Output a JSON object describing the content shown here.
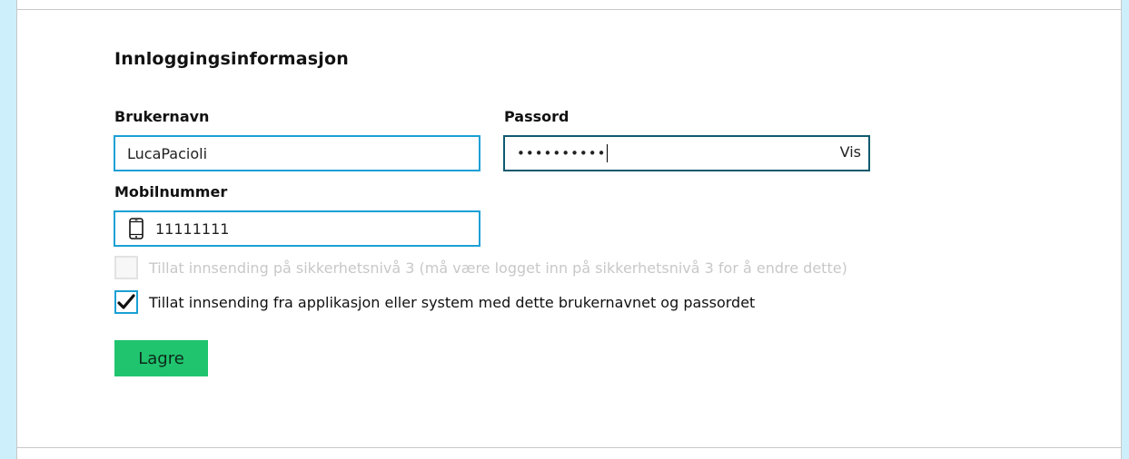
{
  "section": {
    "title": "Innloggingsinformasjon"
  },
  "username": {
    "label": "Brukernavn",
    "value": "LucaPacioli"
  },
  "password": {
    "label": "Passord",
    "masked_value": "••••••••••",
    "show_label": "Vis"
  },
  "mobile": {
    "label": "Mobilnummer",
    "value": "11111111",
    "icon": "mobile-phone-icon"
  },
  "checkboxes": [
    {
      "label": "Tillat innsending på sikkerhetsnivå 3 (må være logget inn på sikkerhetsnivå 3 for å endre dette)",
      "checked": false,
      "disabled": true
    },
    {
      "label": "Tillat innsending fra applikasjon eller system med dette brukernavnet og passordet",
      "checked": true,
      "disabled": false
    }
  ],
  "actions": {
    "save_label": "Lagre"
  },
  "colors": {
    "accent": "#1aa0d5",
    "save": "#20c46e",
    "background": "#cdeffb"
  }
}
